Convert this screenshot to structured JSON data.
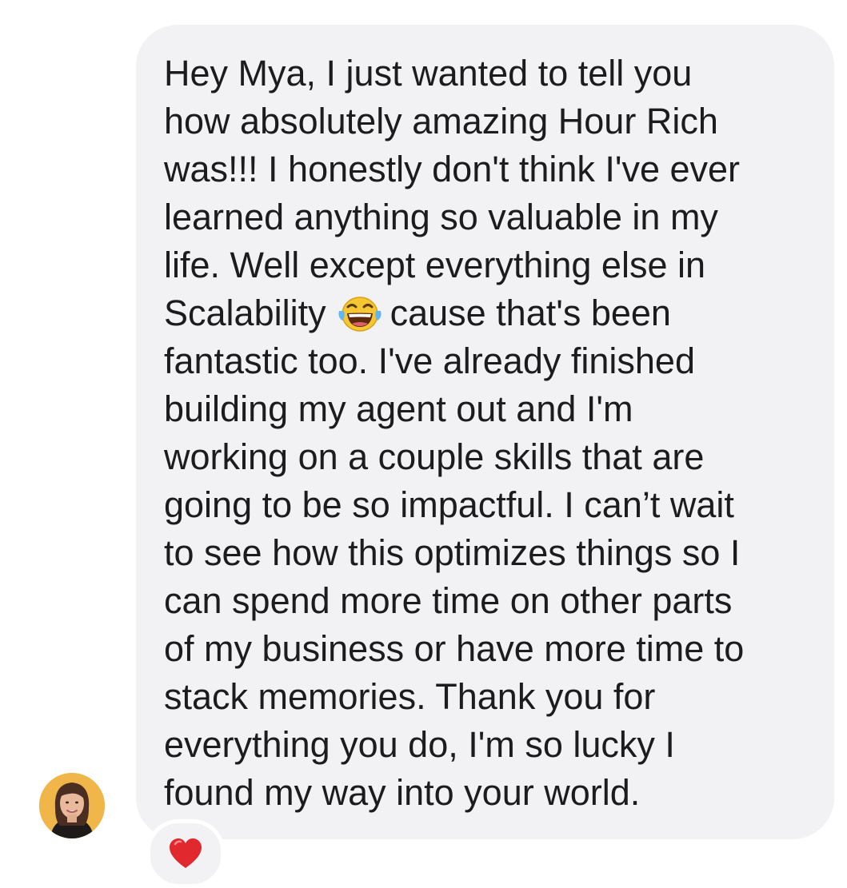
{
  "message": {
    "lines": [
      "Hey Mya, I just wanted to tell you",
      "how absolutely amazing Hour Rich",
      "was!!! I honestly don't think I've ever",
      "learned anything so valuable in my",
      "life. Well except everything else in",
      "Scalability",
      "cause that's been",
      "fantastic too. I've already finished",
      "building my agent out and I'm",
      "working on a couple skills that are",
      "going to be so impactful. I can’t wait",
      "to see how this optimizes things so I",
      "can spend more time on other parts",
      "of my business or have more time to",
      "stack memories. Thank you for",
      "everything you do, I'm so lucky I",
      "found my way into your world."
    ],
    "emoji": "laughing-with-tears-emoji"
  },
  "reaction": {
    "emoji": "red-heart-emoji"
  },
  "avatar": {
    "icon": "sender-avatar"
  },
  "colors": {
    "bubble": "#f2f2f4",
    "text": "#1c1c1e",
    "heart": "#e0282e",
    "avatar_bg": "#f0b64a"
  }
}
